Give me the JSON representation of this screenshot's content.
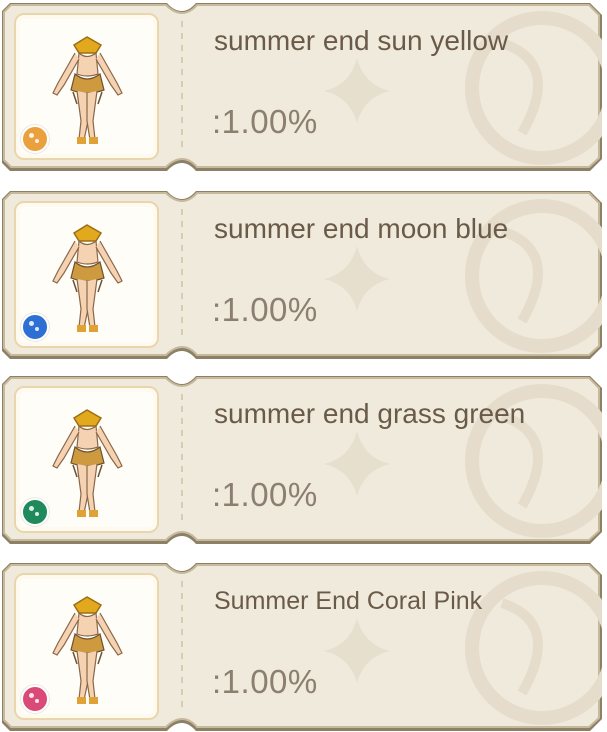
{
  "items": [
    {
      "name": "summer end sun yellow",
      "rate": ":1.00%",
      "dye_color": "#eaa13d",
      "icon": "outfit-icon"
    },
    {
      "name": "summer end moon blue",
      "rate": ":1.00%",
      "dye_color": "#2d6fd3",
      "icon": "outfit-icon"
    },
    {
      "name": "summer end grass green",
      "rate": ":1.00%",
      "dye_color": "#1f8a5b",
      "icon": "outfit-icon"
    },
    {
      "name": "Summer End Coral Pink",
      "rate": ":1.00%",
      "dye_color": "#d94a78",
      "icon": "outfit-icon"
    }
  ],
  "colors": {
    "card_bg": "#f0eadc",
    "card_border": "#c7b99b",
    "card_dark_edge": "#8c8066",
    "frame_border": "#e9d6ad",
    "name_text": "#6a5a48",
    "rate_text": "#8c7f70"
  }
}
